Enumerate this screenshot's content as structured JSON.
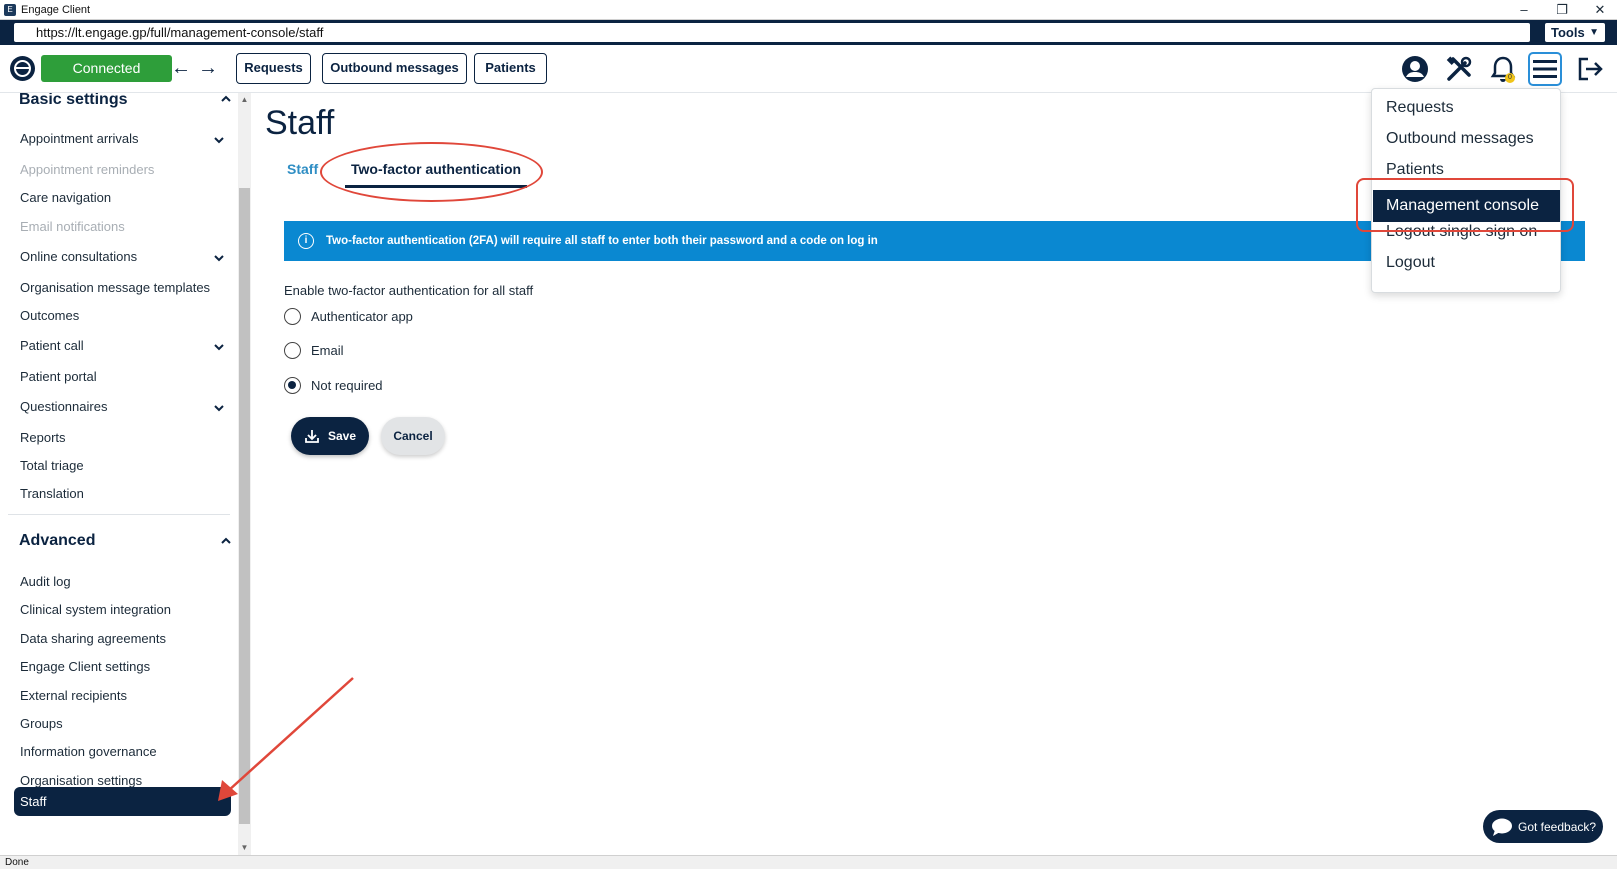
{
  "window": {
    "title": "Engage Client",
    "minimize": "–",
    "restore": "❐",
    "close": "✕"
  },
  "address": {
    "url": "https://lt.engage.gp/full/management-console/staff",
    "tools_label": "Tools",
    "tools_arrow": "▼"
  },
  "toolbar": {
    "status": "Connected",
    "back": "←",
    "forward": "→",
    "buttons": [
      "Requests",
      "Outbound messages",
      "Patients"
    ],
    "bell_badge": "0"
  },
  "sidebar": {
    "basic_header": "Basic settings",
    "basic_items": [
      {
        "label": "Appointment arrivals",
        "expandable": true,
        "disabled": false
      },
      {
        "label": "Appointment reminders",
        "expandable": false,
        "disabled": true
      },
      {
        "label": "Care navigation",
        "expandable": false,
        "disabled": false
      },
      {
        "label": "Email notifications",
        "expandable": false,
        "disabled": true
      },
      {
        "label": "Online consultations",
        "expandable": true,
        "disabled": false
      },
      {
        "label": "Organisation message templates",
        "expandable": false,
        "disabled": false
      },
      {
        "label": "Outcomes",
        "expandable": false,
        "disabled": false
      },
      {
        "label": "Patient call",
        "expandable": true,
        "disabled": false
      },
      {
        "label": "Patient portal",
        "expandable": false,
        "disabled": false
      },
      {
        "label": "Questionnaires",
        "expandable": true,
        "disabled": false
      },
      {
        "label": "Reports",
        "expandable": false,
        "disabled": false
      },
      {
        "label": "Total triage",
        "expandable": false,
        "disabled": false
      },
      {
        "label": "Translation",
        "expandable": false,
        "disabled": false
      }
    ],
    "advanced_header": "Advanced",
    "advanced_items": [
      "Audit log",
      "Clinical system integration",
      "Data sharing agreements",
      "Engage Client settings",
      "External recipients",
      "Groups",
      "Information governance",
      "Organisation settings"
    ],
    "active_item": "Staff"
  },
  "main": {
    "title": "Staff",
    "tabs": [
      {
        "label": "Staff",
        "active": false
      },
      {
        "label": "Two-factor authentication",
        "active": true
      }
    ],
    "banner": "Two-factor authentication (2FA) will require all staff to enter both their password and a code on log in",
    "radio_heading": "Enable two-factor authentication for all staff",
    "options": [
      {
        "label": "Authenticator app",
        "checked": false
      },
      {
        "label": "Email",
        "checked": false
      },
      {
        "label": "Not required",
        "checked": true
      }
    ],
    "save_label": "Save",
    "cancel_label": "Cancel"
  },
  "menu": {
    "items": [
      "Requests",
      "Outbound messages",
      "Patients"
    ],
    "active": "Management console",
    "items_after": [
      "Logout single sign on",
      "Logout"
    ]
  },
  "feedback_label": "Got feedback?",
  "status_text": "Done",
  "colors": {
    "navy": "#0b2341",
    "connected_green": "#2e9e3a",
    "banner_blue": "#0a88d1",
    "annotation_red": "#e0473a",
    "tab_link": "#2f8ec4"
  }
}
